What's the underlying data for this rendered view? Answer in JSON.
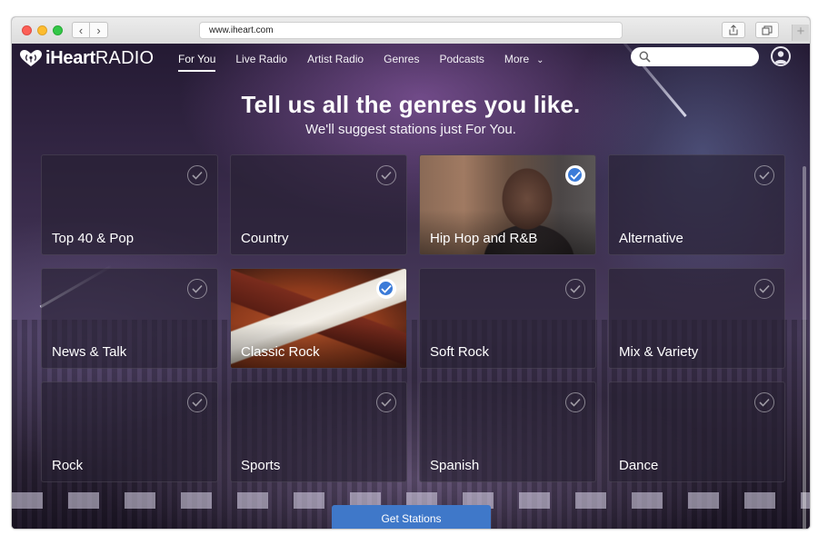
{
  "browser": {
    "url": "www.iheart.com",
    "back_icon": "chevron-left-icon",
    "forward_icon": "chevron-right-icon",
    "share_icon": "share-icon",
    "tabs_icon": "tabs-icon",
    "new_tab_icon": "plus-icon"
  },
  "header": {
    "logo_part1": "iHeart",
    "logo_part2": "RADIO",
    "nav": [
      {
        "label": "For You",
        "active": true
      },
      {
        "label": "Live Radio"
      },
      {
        "label": "Artist Radio"
      },
      {
        "label": "Genres"
      },
      {
        "label": "Podcasts"
      },
      {
        "label": "More"
      }
    ],
    "search_placeholder": "",
    "search_icon": "search-icon",
    "avatar_icon": "user-icon"
  },
  "main": {
    "title": "Tell us all the genres you like.",
    "subtitle": "We'll suggest stations just For You.",
    "genres": [
      {
        "label": "Top 40 & Pop",
        "selected": false
      },
      {
        "label": "Country",
        "selected": false
      },
      {
        "label": "Hip Hop and R&B",
        "selected": true
      },
      {
        "label": "Alternative",
        "selected": false
      },
      {
        "label": "News & Talk",
        "selected": false
      },
      {
        "label": "Classic Rock",
        "selected": true
      },
      {
        "label": "Soft Rock",
        "selected": false
      },
      {
        "label": "Mix & Variety",
        "selected": false
      },
      {
        "label": "Rock",
        "selected": false
      },
      {
        "label": "Sports",
        "selected": false
      },
      {
        "label": "Spanish",
        "selected": false
      },
      {
        "label": "Dance",
        "selected": false
      }
    ],
    "cta_label": "Get Stations"
  },
  "colors": {
    "accent": "#3f78c9",
    "check_selected": "#3b7bd8"
  }
}
